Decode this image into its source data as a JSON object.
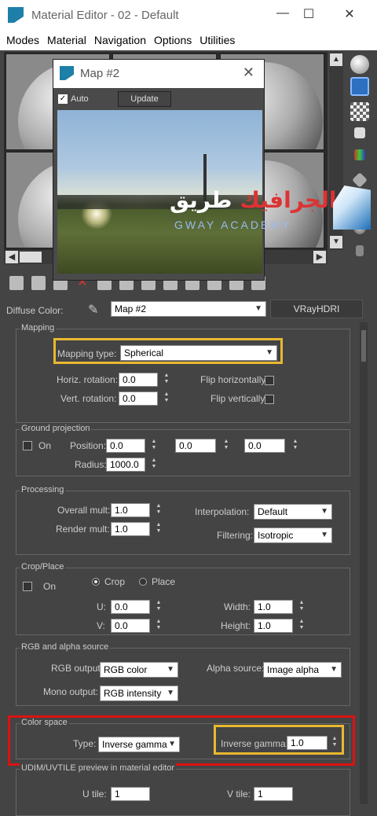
{
  "window": {
    "title": "Material Editor - 02 - Default"
  },
  "menu": [
    "Modes",
    "Material",
    "Navigation",
    "Options",
    "Utilities"
  ],
  "diffuse": {
    "label": "Diffuse Color:",
    "map_value": "Map #2",
    "type_button": "VRayHDRI"
  },
  "map_window": {
    "title": "Map #2",
    "auto_label": "Auto",
    "auto_checked": "✓",
    "update_label": "Update"
  },
  "watermark": {
    "arabic_prefix": "طريق",
    "arabic_main": "الجرافيك",
    "english": "GWAY ACADEMY"
  },
  "mapping": {
    "group_label": "Mapping",
    "type_label": "Mapping type:",
    "type_value": "Spherical",
    "horiz_label": "Horiz. rotation:",
    "horiz_value": "0.0",
    "vert_label": "Vert. rotation:",
    "vert_value": "0.0",
    "flip_h_label": "Flip horizontally",
    "flip_v_label": "Flip vertically"
  },
  "ground": {
    "group_label": "Ground projection",
    "on_label": "On",
    "position_label": "Position:",
    "pos_x": "0.0",
    "pos_y": "0.0",
    "pos_z": "0.0",
    "radius_label": "Radius:",
    "radius_value": "1000.0"
  },
  "processing": {
    "group_label": "Processing",
    "overall_label": "Overall mult:",
    "overall_value": "1.0",
    "render_label": "Render mult:",
    "render_value": "1.0",
    "interp_label": "Interpolation:",
    "interp_value": "Default",
    "filter_label": "Filtering:",
    "filter_value": "Isotropic"
  },
  "crop": {
    "group_label": "Crop/Place",
    "on_label": "On",
    "crop_label": "Crop",
    "place_label": "Place",
    "u_label": "U:",
    "u_value": "0.0",
    "v_label": "V:",
    "v_value": "0.0",
    "w_label": "Width:",
    "w_value": "1.0",
    "h_label": "Height:",
    "h_value": "1.0"
  },
  "rgb": {
    "group_label": "RGB and alpha source",
    "rgb_label": "RGB output:",
    "rgb_value": "RGB color",
    "alpha_label": "Alpha source:",
    "alpha_value": "Image alpha",
    "mono_label": "Mono output:",
    "mono_value": "RGB intensity"
  },
  "colorspace": {
    "group_label": "Color space",
    "type_label": "Type:",
    "type_value": "Inverse gamma",
    "gamma_label": "Inverse gamma:",
    "gamma_value": "1.0"
  },
  "udim": {
    "group_label": "UDIM/UVTILE preview in material editor",
    "u_label": "U tile:",
    "u_value": "1",
    "v_label": "V tile:",
    "v_value": "1"
  },
  "colors": {
    "highlight_yellow": "#e8b830",
    "highlight_red": "#dd1111",
    "panel_bg": "#444444"
  }
}
